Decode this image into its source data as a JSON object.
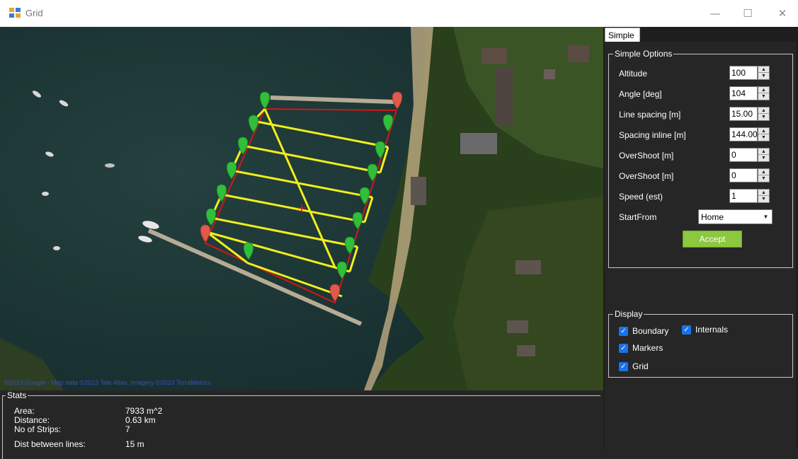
{
  "window": {
    "title": "Grid",
    "controls": {
      "minimize": "—",
      "maximize": "☐",
      "close": "✕"
    }
  },
  "map": {
    "attribution": "©2023 Google - Map data ©2023 Tele Atlas, Imagery ©2023 TerraMetrics"
  },
  "stats": {
    "legend": "Stats",
    "rows": [
      {
        "label": "Area:",
        "value": "7933 m^2"
      },
      {
        "label": "Distance:",
        "value": "0.63 km"
      },
      {
        "label": "No of Strips:",
        "value": "7"
      },
      {
        "label": "Dist between lines:",
        "value": "15 m"
      }
    ]
  },
  "tabs": [
    {
      "label": "Simple",
      "selected": true
    }
  ],
  "simple_options": {
    "legend": "Simple Options",
    "fields": [
      {
        "label": "Altitude",
        "value": "100"
      },
      {
        "label": "Angle [deg]",
        "value": "104"
      },
      {
        "label": "Line spacing [m]",
        "value": "15.00"
      },
      {
        "label": "Spacing inline [m]",
        "value": "144.00"
      },
      {
        "label": "OverShoot [m]",
        "value": "0"
      },
      {
        "label": "OverShoot [m]",
        "value": "0"
      },
      {
        "label": "Speed (est)",
        "value": "1"
      }
    ],
    "start_from": {
      "label": "StartFrom",
      "value": "Home"
    },
    "accept_label": "Accept"
  },
  "display": {
    "legend": "Display",
    "options": [
      {
        "label": "Boundary",
        "checked": true
      },
      {
        "label": "Internals",
        "checked": true
      },
      {
        "label": "Markers",
        "checked": true
      },
      {
        "label": "Grid",
        "checked": true
      }
    ]
  },
  "colors": {
    "accent_button": "#8dc63f",
    "checkbox": "#1a73e8",
    "grid_line": "#f2ee1c",
    "boundary_line": "#d11818",
    "marker_green": "#2fbf3a",
    "marker_red": "#e05a4c"
  },
  "icons": {
    "app": "grid-app-icon",
    "spin_up": "triangle-up-icon",
    "spin_down": "triangle-down-icon",
    "dropdown": "triangle-down-icon",
    "check": "checkmark-icon"
  }
}
